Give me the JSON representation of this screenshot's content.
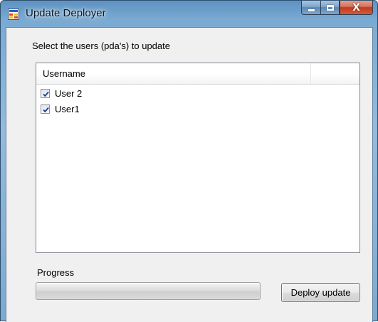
{
  "window": {
    "title": "Update Deployer",
    "icon": "app-window-icon",
    "caption_buttons": [
      "minimize-icon",
      "maximize-icon",
      "close-icon"
    ],
    "close_glyph": "X"
  },
  "main": {
    "instruction": "Select the users (pda's) to update",
    "list": {
      "columns": [
        "Username",
        ""
      ],
      "rows": [
        {
          "label": "User 2",
          "checked": true
        },
        {
          "label": "User1",
          "checked": true
        }
      ]
    },
    "progress": {
      "label": "Progress",
      "value": 0
    },
    "deploy_button": "Deploy update"
  },
  "colors": {
    "accent": "#7aaad2",
    "close_button": "#c2391c",
    "client_background": "#f0f0f0"
  }
}
